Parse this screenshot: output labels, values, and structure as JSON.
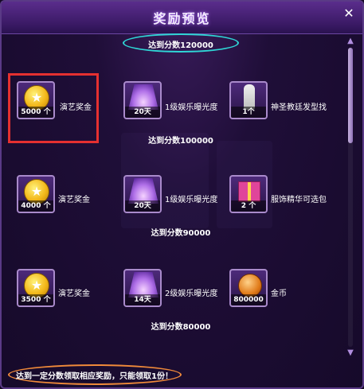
{
  "dialog": {
    "title": "奖励预览",
    "close_symbol": "✕"
  },
  "tiers": [
    {
      "label": "达到分数120000",
      "items": []
    },
    {
      "label": "达到分数100000",
      "items": [
        {
          "icon": "gold-coin-icon",
          "count": "5000 个",
          "name": "演艺奖金"
        },
        {
          "icon": "stage-light-icon",
          "count": "20天",
          "name": "1级娱乐曝光度"
        },
        {
          "icon": "white-outfit-icon",
          "count": "1个",
          "name": "神圣教廷发型找"
        }
      ]
    },
    {
      "label": "达到分数90000",
      "items": [
        {
          "icon": "gold-coin-icon",
          "count": "4000 个",
          "name": "演艺奖金"
        },
        {
          "icon": "stage-light-icon",
          "count": "20天",
          "name": "1级娱乐曝光度"
        },
        {
          "icon": "gift-box-icon",
          "count": "2 个",
          "name": "服饰精华可选包"
        }
      ]
    },
    {
      "label": "达到分数80000",
      "items": [
        {
          "icon": "gold-coin-icon",
          "count": "3500 个",
          "name": "演艺奖金"
        },
        {
          "icon": "stage-light-icon",
          "count": "14天",
          "name": "2级娱乐曝光度"
        },
        {
          "icon": "coin-pile-icon",
          "count": "800000",
          "name": "金币"
        }
      ]
    }
  ],
  "footer": {
    "notice": "达到一定分数领取相应奖励，只能领取1份！"
  },
  "colors": {
    "highlight_box": "#e53030",
    "top_oval": "#2fd6d6",
    "footer_oval": "#f08a3a"
  }
}
